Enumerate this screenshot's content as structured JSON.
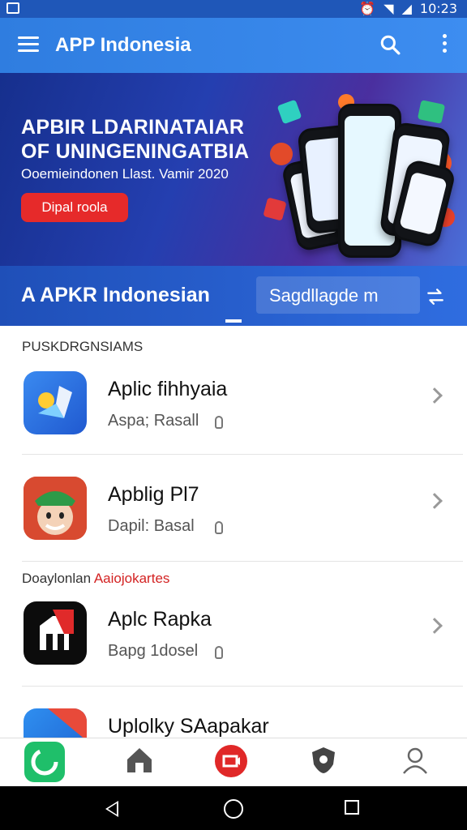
{
  "status": {
    "time": "10:23"
  },
  "appbar": {
    "title": "APP Indonesia"
  },
  "banner": {
    "headline_line1": "APBIR LDARINATAIAR",
    "headline_line2": "OF UNINGENINGATBIA",
    "subtitle": "Ooemieindonen Llast. Vamir 2020",
    "cta_label": "Dipal roola"
  },
  "subbar": {
    "label": "A APKR Indonesian",
    "tab_label": "Sagdllagde m"
  },
  "sections": [
    {
      "label": "PUSKDRGNSIAMS"
    },
    {
      "label_plain": "Doaylonlan ",
      "label_red": "Aaiojokartes"
    }
  ],
  "apps": [
    {
      "name": "Aplic fihhyaia",
      "meta": "Aspa; Rasall"
    },
    {
      "name": "Apblig Pl7",
      "meta": "Dapil: Basal"
    },
    {
      "name": "Aplc Rapka",
      "meta": "Bapg 1dosel"
    },
    {
      "name": "Uplolky SAapakar",
      "meta": ""
    }
  ],
  "colors": {
    "primary": "#2f7de0",
    "accent": "#e62a2a",
    "dark": "#162f8d"
  }
}
